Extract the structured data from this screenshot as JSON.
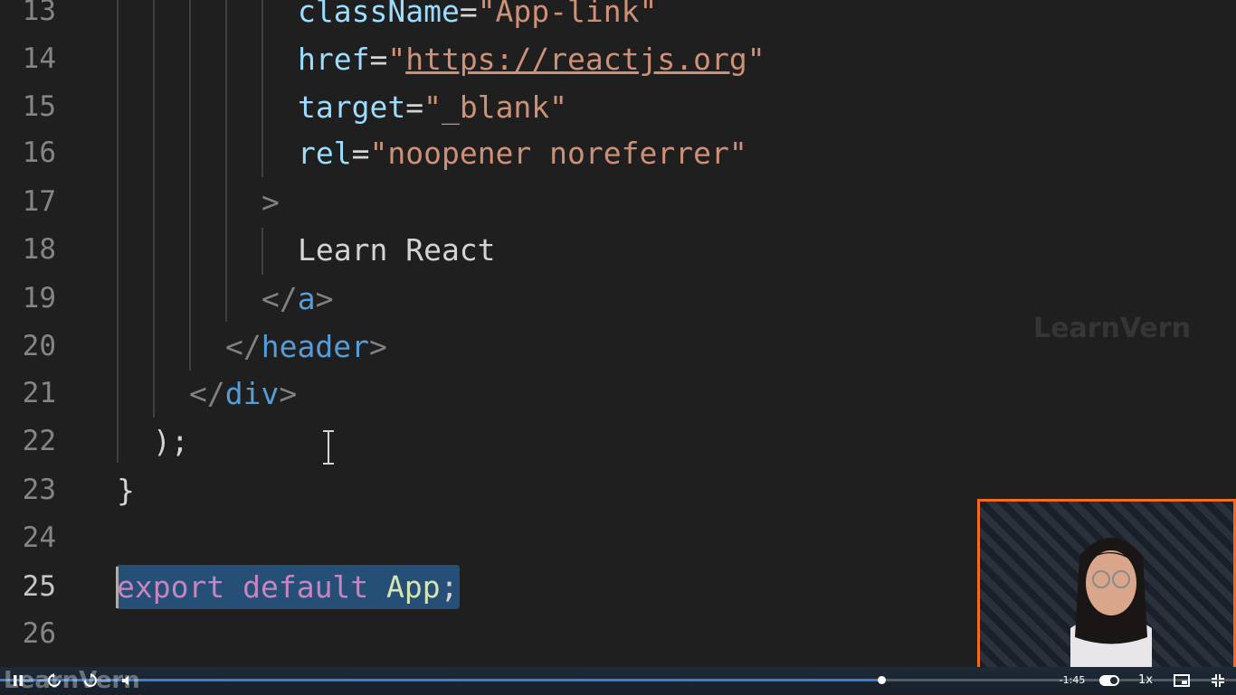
{
  "editor": {
    "lines": [
      {
        "num": "13"
      },
      {
        "num": "14"
      },
      {
        "num": "15"
      },
      {
        "num": "16"
      },
      {
        "num": "17"
      },
      {
        "num": "18"
      },
      {
        "num": "19"
      },
      {
        "num": "20"
      },
      {
        "num": "21"
      },
      {
        "num": "22"
      },
      {
        "num": "23"
      },
      {
        "num": "24"
      },
      {
        "num": "25"
      },
      {
        "num": "26"
      }
    ],
    "code": {
      "l13_attr": "className",
      "l13_eq": "=",
      "l13_str": "\"App-link\"",
      "l14_attr": "href",
      "l14_eq": "=",
      "l14_q1": "\"",
      "l14_url": "https://reactjs.org",
      "l14_q2": "\"",
      "l15_attr": "target",
      "l15_eq": "=",
      "l15_str": "\"_blank\"",
      "l16_attr": "rel",
      "l16_eq": "=",
      "l16_str": "\"noopener noreferrer\"",
      "l17_gt": ">",
      "l18_text": "Learn React",
      "l19_open": "</",
      "l19_tag": "a",
      "l19_close": ">",
      "l20_open": "</",
      "l20_tag": "header",
      "l20_close": ">",
      "l21_open": "</",
      "l21_tag": "div",
      "l21_close": ">",
      "l22_text": ");",
      "l23_text": "}",
      "l25_kw1": "export",
      "l25_kw2": "default",
      "l25_id": "App",
      "l25_semi": ";"
    },
    "active_line": "25"
  },
  "watermark": "LearnVern",
  "player": {
    "brand": "LearnVern",
    "time_remaining": "-1:45",
    "speed": "1x",
    "progress": 0.713,
    "accent": "#f26b21"
  }
}
